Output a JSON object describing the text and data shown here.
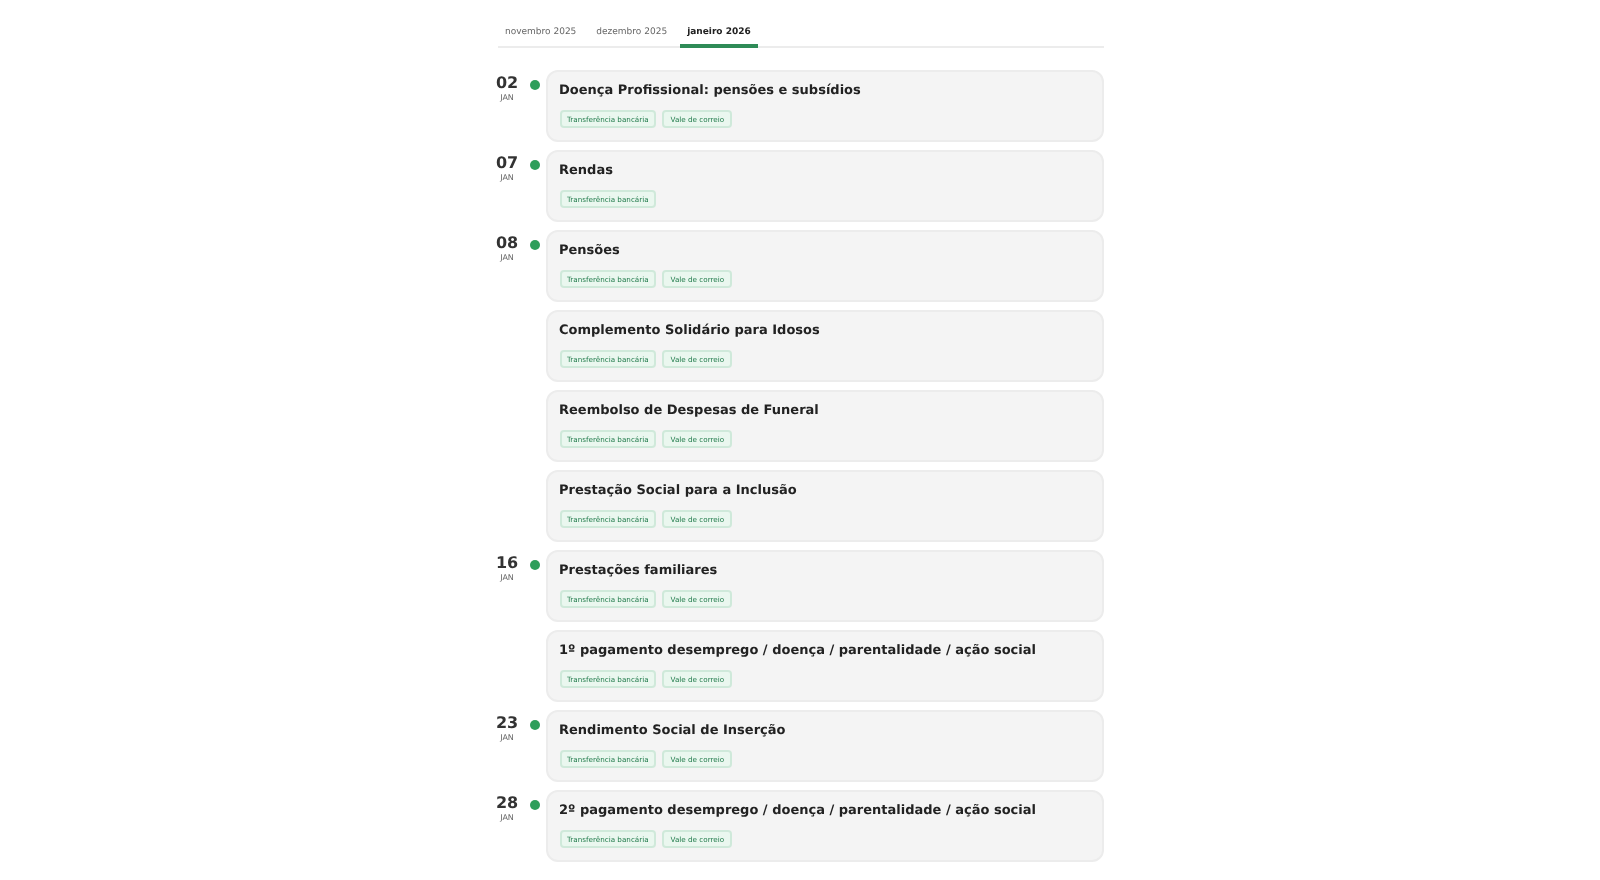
{
  "tabs": [
    {
      "label": "novembro 2025",
      "selected": false
    },
    {
      "label": "dezembro 2025",
      "selected": false
    },
    {
      "label": "janeiro 2026",
      "selected": true
    }
  ],
  "days": [
    {
      "day": "02",
      "month": "JAN",
      "payments": [
        {
          "title": "Doença Profissional: pensões e subsídios",
          "tags": [
            "Transferência bancária",
            "Vale de correio"
          ]
        }
      ]
    },
    {
      "day": "07",
      "month": "JAN",
      "payments": [
        {
          "title": "Rendas",
          "tags": [
            "Transferência bancária"
          ]
        }
      ]
    },
    {
      "day": "08",
      "month": "JAN",
      "payments": [
        {
          "title": "Pensões",
          "tags": [
            "Transferência bancária",
            "Vale de correio"
          ]
        },
        {
          "title": "Complemento Solidário para Idosos",
          "tags": [
            "Transferência bancária",
            "Vale de correio"
          ]
        },
        {
          "title": "Reembolso de Despesas de Funeral",
          "tags": [
            "Transferência bancária",
            "Vale de correio"
          ]
        },
        {
          "title": "Prestação Social para a Inclusão",
          "tags": [
            "Transferência bancária",
            "Vale de correio"
          ]
        }
      ]
    },
    {
      "day": "16",
      "month": "JAN",
      "payments": [
        {
          "title": "Prestações familiares",
          "tags": [
            "Transferência bancária",
            "Vale de correio"
          ]
        },
        {
          "title": "1º pagamento desemprego / doença / parentalidade / ação social",
          "tags": [
            "Transferência bancária",
            "Vale de correio"
          ]
        }
      ]
    },
    {
      "day": "23",
      "month": "JAN",
      "payments": [
        {
          "title": "Rendimento Social de Inserção",
          "tags": [
            "Transferência bancária",
            "Vale de correio"
          ]
        }
      ]
    },
    {
      "day": "28",
      "month": "JAN",
      "payments": [
        {
          "title": "2º pagamento desemprego / doença / parentalidade / ação social",
          "tags": [
            "Transferência bancária",
            "Vale de correio"
          ]
        }
      ]
    }
  ]
}
